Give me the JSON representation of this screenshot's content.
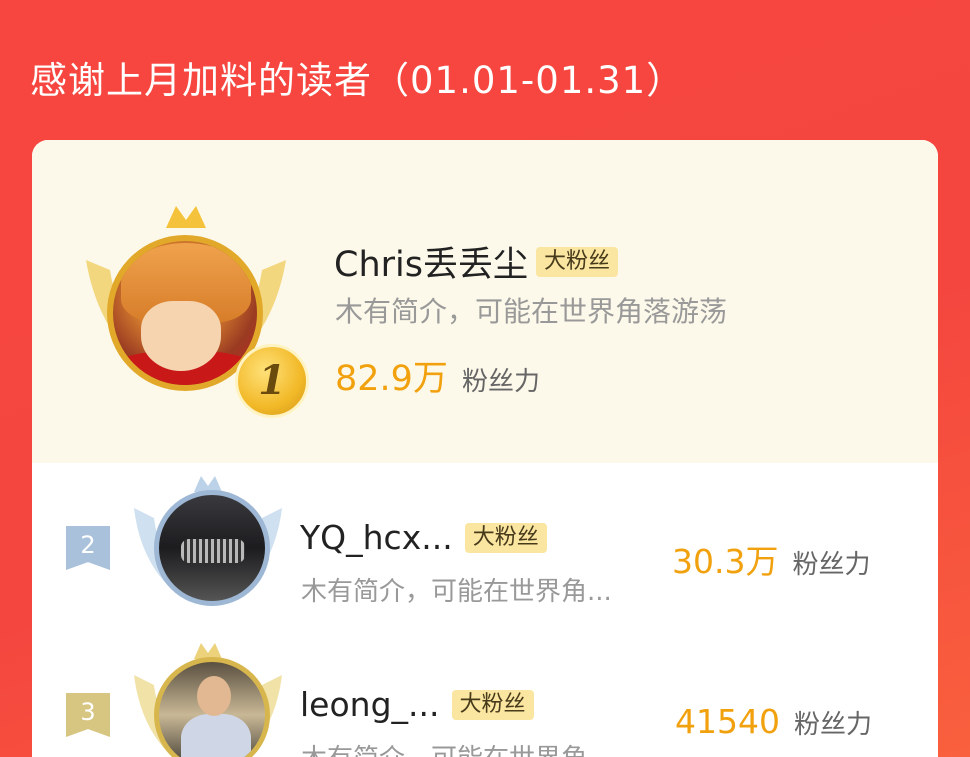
{
  "header": {
    "title": "感谢上月加料的读者（01.01-01.31）"
  },
  "badge_label": "大粉丝",
  "score_unit": "粉丝力",
  "colors": {
    "background": "#f4453f",
    "score": "#f2a10e",
    "badge_bg": "#fae6a0",
    "rank1_accent": "#e1a82a",
    "rank2_accent": "#9db7d4",
    "rank3_accent": "#d7b64e"
  },
  "top_fan": {
    "rank": "1",
    "name": "Chris丢丢尘",
    "bio": "木有简介，可能在世界角落游荡",
    "score": "82.9万",
    "avatar_icon": "anime-avatar"
  },
  "fans": [
    {
      "rank": "2",
      "name": "YQ_hcx...",
      "bio": "木有简介，可能在世界角...",
      "score": "30.3万",
      "avatar_icon": "car-avatar"
    },
    {
      "rank": "3",
      "name": "leong_...",
      "bio": "木有简介，可能在世界角...",
      "score": "41540",
      "avatar_icon": "person-avatar"
    }
  ]
}
